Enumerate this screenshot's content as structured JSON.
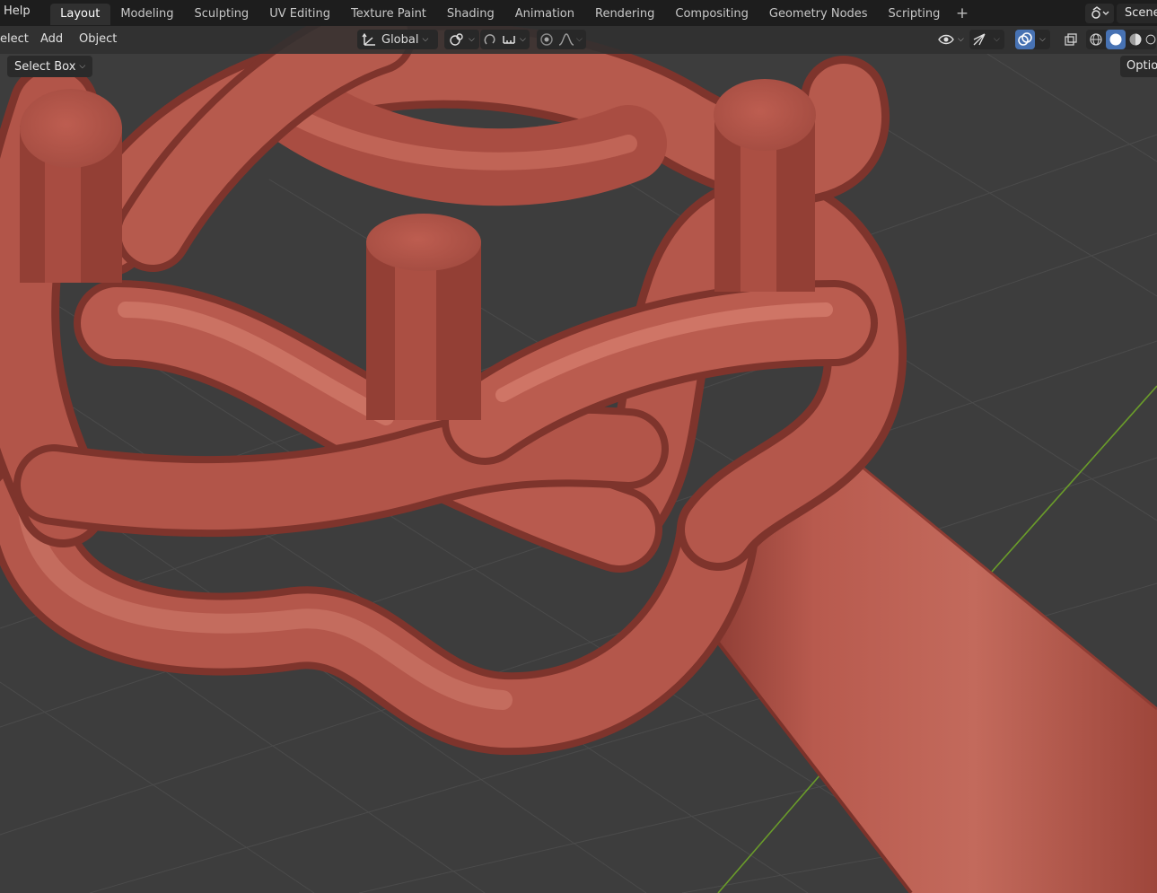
{
  "topbar": {
    "help": "Help",
    "tabs": [
      {
        "label": "Layout",
        "active": true
      },
      {
        "label": "Modeling",
        "active": false
      },
      {
        "label": "Sculpting",
        "active": false
      },
      {
        "label": "UV Editing",
        "active": false
      },
      {
        "label": "Texture Paint",
        "active": false
      },
      {
        "label": "Shading",
        "active": false
      },
      {
        "label": "Animation",
        "active": false
      },
      {
        "label": "Rendering",
        "active": false
      },
      {
        "label": "Compositing",
        "active": false
      },
      {
        "label": "Geometry Nodes",
        "active": false
      },
      {
        "label": "Scripting",
        "active": false
      }
    ],
    "add_tab": "+",
    "scene_label": "Scene"
  },
  "viewport_header": {
    "menus": {
      "select": "elect",
      "add": "Add",
      "object": "Object"
    },
    "orientation": "Global",
    "icons": [
      "transform-orientation-icon",
      "snap-pivot-icon",
      "snap-magnet-icon",
      "snap-increment-icon",
      "proportional-edit-icon",
      "falloff-curve-icon",
      "visibility-eye-icon",
      "gizmo-icon",
      "overlay-icon",
      "xray-icon",
      "wireframe-shading-icon",
      "solid-shading-icon",
      "material-shading-icon",
      "rendered-shading-icon"
    ]
  },
  "tool_header": {
    "select_mode": "Select Box",
    "options": "Options"
  },
  "colors": {
    "topbar": "#1d1d1d",
    "header": "#303030",
    "viewport_bg": "#3d3d3d",
    "grid": "#4a4a4a",
    "y_axis": "#6a9c2a",
    "mesh": "#b85a4e",
    "active_blue": "#4772b3"
  }
}
